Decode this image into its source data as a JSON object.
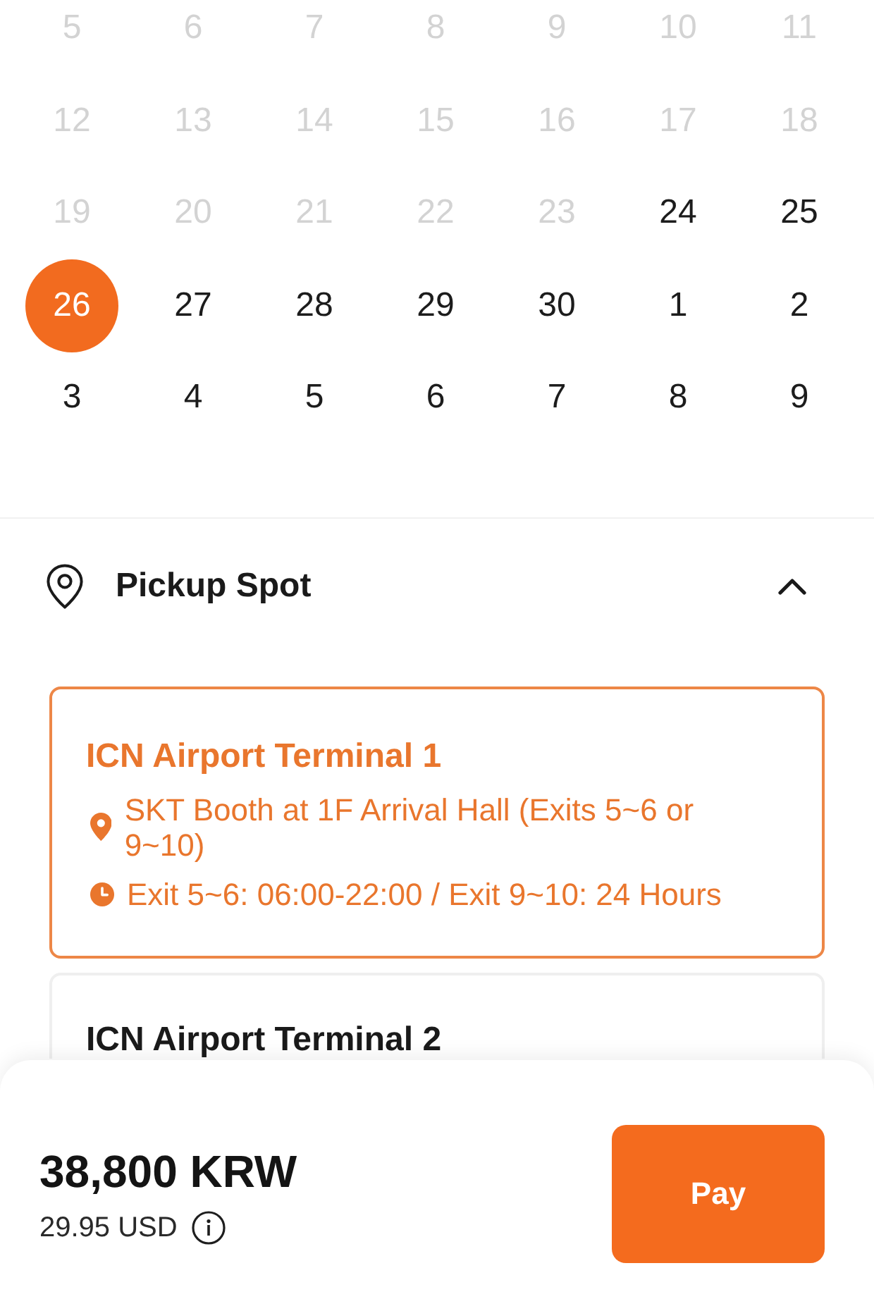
{
  "calendar": {
    "weeks": [
      [
        {
          "label": "5",
          "disabled": true,
          "selected": false
        },
        {
          "label": "6",
          "disabled": true,
          "selected": false
        },
        {
          "label": "7",
          "disabled": true,
          "selected": false
        },
        {
          "label": "8",
          "disabled": true,
          "selected": false
        },
        {
          "label": "9",
          "disabled": true,
          "selected": false
        },
        {
          "label": "10",
          "disabled": true,
          "selected": false
        },
        {
          "label": "11",
          "disabled": true,
          "selected": false
        }
      ],
      [
        {
          "label": "12",
          "disabled": true,
          "selected": false
        },
        {
          "label": "13",
          "disabled": true,
          "selected": false
        },
        {
          "label": "14",
          "disabled": true,
          "selected": false
        },
        {
          "label": "15",
          "disabled": true,
          "selected": false
        },
        {
          "label": "16",
          "disabled": true,
          "selected": false
        },
        {
          "label": "17",
          "disabled": true,
          "selected": false
        },
        {
          "label": "18",
          "disabled": true,
          "selected": false
        }
      ],
      [
        {
          "label": "19",
          "disabled": true,
          "selected": false
        },
        {
          "label": "20",
          "disabled": true,
          "selected": false
        },
        {
          "label": "21",
          "disabled": true,
          "selected": false
        },
        {
          "label": "22",
          "disabled": true,
          "selected": false
        },
        {
          "label": "23",
          "disabled": true,
          "selected": false
        },
        {
          "label": "24",
          "disabled": false,
          "selected": false
        },
        {
          "label": "25",
          "disabled": false,
          "selected": false
        }
      ],
      [
        {
          "label": "26",
          "disabled": false,
          "selected": true
        },
        {
          "label": "27",
          "disabled": false,
          "selected": false
        },
        {
          "label": "28",
          "disabled": false,
          "selected": false
        },
        {
          "label": "29",
          "disabled": false,
          "selected": false
        },
        {
          "label": "30",
          "disabled": false,
          "selected": false
        },
        {
          "label": "1",
          "disabled": false,
          "selected": false
        },
        {
          "label": "2",
          "disabled": false,
          "selected": false
        }
      ],
      [
        {
          "label": "3",
          "disabled": false,
          "selected": false
        },
        {
          "label": "4",
          "disabled": false,
          "selected": false
        },
        {
          "label": "5",
          "disabled": false,
          "selected": false
        },
        {
          "label": "6",
          "disabled": false,
          "selected": false
        },
        {
          "label": "7",
          "disabled": false,
          "selected": false
        },
        {
          "label": "8",
          "disabled": false,
          "selected": false
        },
        {
          "label": "9",
          "disabled": false,
          "selected": false
        }
      ]
    ]
  },
  "pickup": {
    "title": "Pickup Spot",
    "expanded": true,
    "options": [
      {
        "name": "ICN Airport Terminal 1",
        "selected": true,
        "details": [
          {
            "kind": "location",
            "text": "SKT Booth at 1F Arrival Hall (Exits 5~6 or 9~10)"
          },
          {
            "kind": "hours",
            "text": "Exit 5~6: 06:00-22:00 / Exit 9~10: 24 Hours"
          }
        ]
      },
      {
        "name": "ICN Airport Terminal 2",
        "selected": false
      }
    ]
  },
  "footer": {
    "price": "38,800 KRW",
    "converted": "29.95 USD",
    "button": "Pay"
  }
}
